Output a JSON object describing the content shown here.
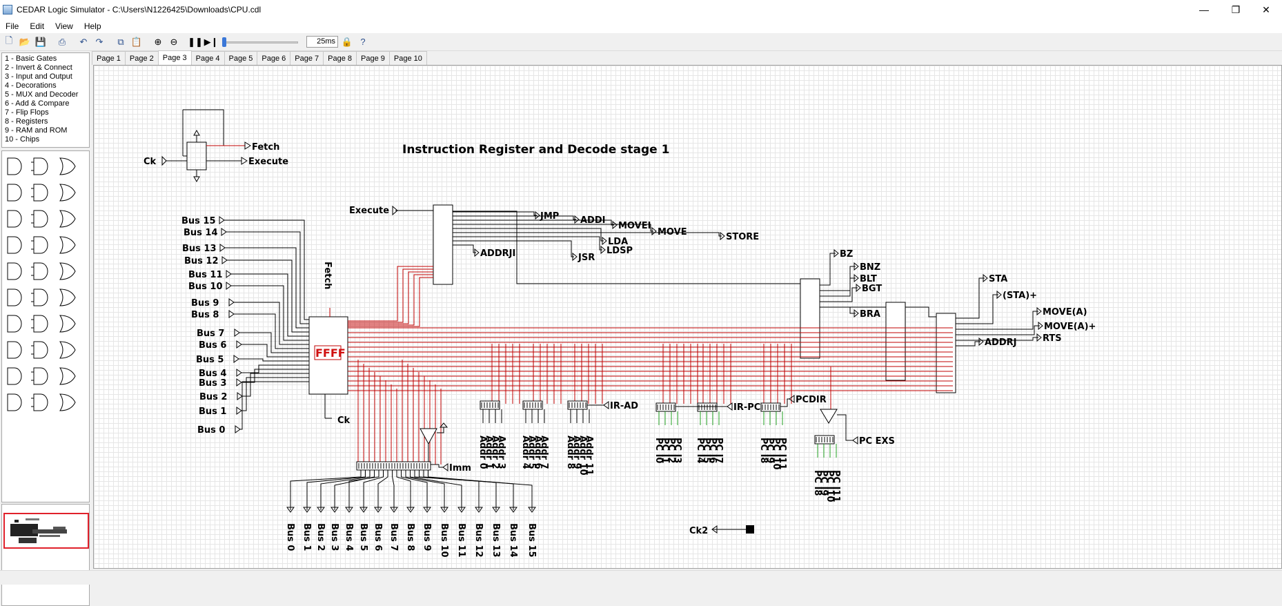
{
  "window": {
    "title": "CEDAR Logic Simulator - C:\\Users\\N1226425\\Downloads\\CPU.cdl",
    "minimize": "—",
    "maximize": "❐",
    "close": "✕"
  },
  "menu": [
    "File",
    "Edit",
    "View",
    "Help"
  ],
  "toolbar": {
    "speed_value": "25ms",
    "slider_level": 0.0
  },
  "library": {
    "items": [
      "1  - Basic Gates",
      "2  - Invert & Connect",
      "3  - Input and Output",
      "4  - Decorations",
      "5  - MUX and Decoder",
      "6  - Add & Compare",
      "7  - Flip Flops",
      "8  - Registers",
      "9  - RAM and ROM",
      "10 - Chips"
    ]
  },
  "tabs": [
    "Page 1",
    "Page 2",
    "Page 3",
    "Page 4",
    "Page 5",
    "Page 6",
    "Page 7",
    "Page 8",
    "Page 9",
    "Page 10"
  ],
  "active_tab": "Page 3",
  "colors": {
    "active_wire": "#c00000",
    "wire": "#000000",
    "green_wire": "#22a022",
    "display": "#d01010"
  },
  "circuit": {
    "title": "Instruction Register and Decode stage 1",
    "display_value": "FFFF",
    "clock_in": "Ck",
    "fetch": "Fetch",
    "execute": "Execute",
    "execute_in": "Execute",
    "fetch_in": "Fetch",
    "ck_reg": "Ck",
    "ck2": "Ck2",
    "bus_inputs": [
      "Bus 15",
      "Bus 14",
      "Bus 13",
      "Bus 12",
      "Bus 11",
      "Bus 10",
      "Bus 9",
      "Bus 8",
      "Bus 7",
      "Bus 6",
      "Bus 5",
      "Bus 4",
      "Bus 3",
      "Bus 2",
      "Bus 1",
      "Bus 0"
    ],
    "decoder1_outputs": [
      "JMP",
      "ADDI",
      "MOVEI",
      "MOVE",
      "LDA",
      "STORE",
      "LDSP",
      "JSR",
      "ADDRJI"
    ],
    "decoder2_outputs": [
      "BZ",
      "BNZ",
      "BLT",
      "BGT",
      "BRA"
    ],
    "decoder3_outputs": [
      "STA",
      "(STA)+",
      "MOVE(A)",
      "MOVE(A)+",
      "RTS",
      "ADDRJ"
    ],
    "ir_ad": "IR-AD",
    "ir_pc": "IR-PC",
    "pcdir": "PCDIR",
    "pc_exs": "PC EXS",
    "imm": "Imm",
    "addr_group1": [
      "Addr 0",
      "Addr 1",
      "Addr 2",
      "Addr 3"
    ],
    "addr_group2": [
      "Addr 4",
      "Addr 5",
      "Addr 6",
      "Addr 7"
    ],
    "addr_group3": [
      "Addr 8",
      "Addr 9",
      "Addr 10",
      "Addr 11"
    ],
    "pc_group1": [
      "PC I0",
      "PC I1",
      "PC I2",
      "PC I3"
    ],
    "pc_group2": [
      "PC I4",
      "PC I5",
      "PC I6",
      "PC I7"
    ],
    "pc_group3": [
      "PC I8",
      "PC I9",
      "PC I10",
      "PC I11"
    ],
    "pc_group4": [
      "PC I8",
      "PC I9",
      "PC I10",
      "PC I11"
    ],
    "bus_outputs": [
      "Bus 0",
      "Bus 1",
      "Bus 2",
      "Bus 3",
      "Bus 4",
      "Bus 5",
      "Bus 6",
      "Bus 7",
      "Bus 8",
      "Bus 9",
      "Bus 10",
      "Bus 11",
      "Bus 12",
      "Bus 13",
      "Bus 14",
      "Bus 15"
    ]
  }
}
